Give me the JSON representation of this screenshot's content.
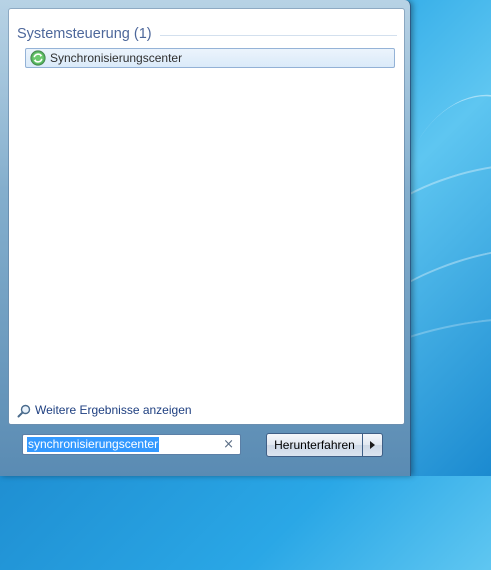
{
  "search_results": {
    "group_title": "Systemsteuerung (1)",
    "items": [
      {
        "label": "Synchronisierungscenter",
        "icon": "sync-center-icon"
      }
    ],
    "more_results_label": "Weitere Ergebnisse anzeigen",
    "more_results_icon": "magnifier-icon"
  },
  "search_box": {
    "value": "synchronisierungscenter",
    "clear_icon": "clear-icon",
    "clear_glyph": "×"
  },
  "shutdown": {
    "label": "Herunterfahren",
    "arrow_icon": "chevron-right-icon"
  },
  "colors": {
    "accent": "#1e3f80",
    "selection": "#3399ff",
    "sync_icon_green": "#2e9c3a"
  }
}
